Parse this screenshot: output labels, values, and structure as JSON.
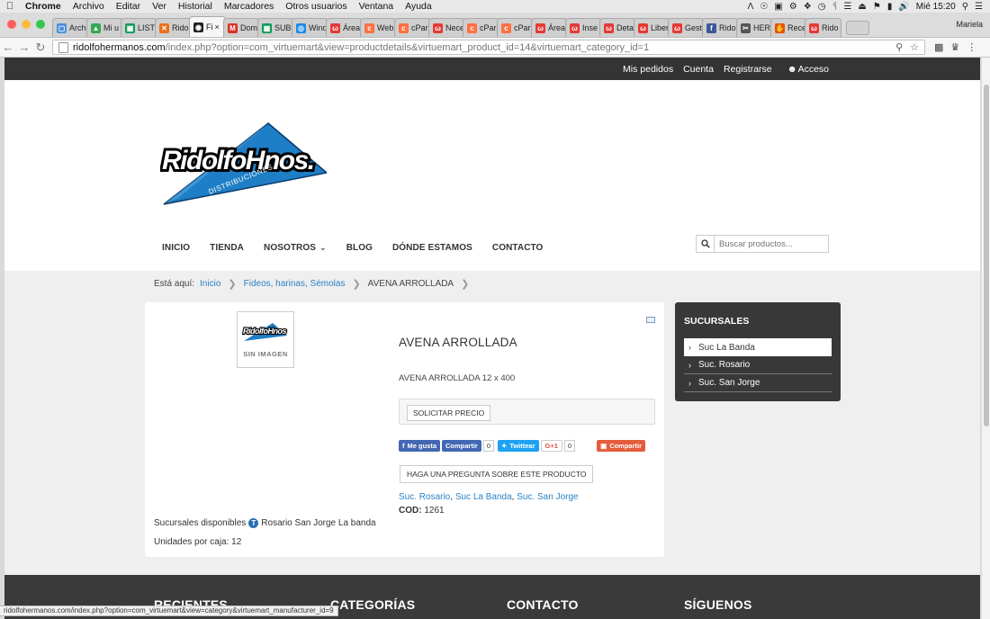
{
  "mac_menu": {
    "apple": "",
    "items": [
      "Chrome",
      "Archivo",
      "Editar",
      "Ver",
      "Historial",
      "Marcadores",
      "Otros usuarios",
      "Ventana",
      "Ayuda"
    ],
    "clock": "Mié 15:20"
  },
  "browser": {
    "tabs": [
      {
        "label": "Arch",
        "color": "#4a90d9",
        "glyph": "▢"
      },
      {
        "label": "Mi u",
        "color": "#34a853",
        "glyph": "▲"
      },
      {
        "label": "LIST",
        "color": "#0f9d58",
        "glyph": "▦"
      },
      {
        "label": "Rido",
        "color": "#e8711c",
        "glyph": "✕"
      },
      {
        "label": "Fi",
        "color": "#222222",
        "glyph": "◉",
        "active": true
      },
      {
        "label": "Dom",
        "color": "#d93025",
        "glyph": "M"
      },
      {
        "label": "SUB",
        "color": "#0f9d58",
        "glyph": "▦"
      },
      {
        "label": "Wind",
        "color": "#1e88e5",
        "glyph": "◎"
      },
      {
        "label": "Área",
        "color": "#e53935",
        "glyph": "ω"
      },
      {
        "label": "Web",
        "color": "#ff7043",
        "glyph": "c"
      },
      {
        "label": "cPar",
        "color": "#ff7043",
        "glyph": "c"
      },
      {
        "label": "Nece",
        "color": "#e53935",
        "glyph": "ω"
      },
      {
        "label": "cPar",
        "color": "#ff7043",
        "glyph": "c"
      },
      {
        "label": "cPar",
        "color": "#ff7043",
        "glyph": "c"
      },
      {
        "label": "Área",
        "color": "#e53935",
        "glyph": "ω"
      },
      {
        "label": "Inse",
        "color": "#e53935",
        "glyph": "ω"
      },
      {
        "label": "Deta",
        "color": "#e53935",
        "glyph": "ω"
      },
      {
        "label": "Liber",
        "color": "#e53935",
        "glyph": "ω"
      },
      {
        "label": "Gest",
        "color": "#e53935",
        "glyph": "ω"
      },
      {
        "label": "Rido",
        "color": "#3b5998",
        "glyph": "f"
      },
      {
        "label": "HER",
        "color": "#555555",
        "glyph": "✂"
      },
      {
        "label": "Rece",
        "color": "#e65100",
        "glyph": "✋"
      },
      {
        "label": "Rido",
        "color": "#e53935",
        "glyph": "ω"
      }
    ],
    "close_glyph": "×",
    "profile": "Mariela",
    "url_host": "ridolfohermanos.com",
    "url_rest": "/index.php?option=com_virtuemart&view=productdetails&virtuemart_product_id=14&virtuemart_category_id=1",
    "status_url": "ridolfohermanos.com/index.php?option=com_virtuemart&view=category&virtuemart_manufacturer_id=9"
  },
  "site": {
    "topbar": [
      "Mis pedidos",
      "Cuenta",
      "Registrarse",
      "Acceso"
    ],
    "logo_text": "RidolfoHnos.",
    "logo_sub": "DISTRIBUCIONES",
    "nav": [
      "INICIO",
      "TIENDA",
      "NOSOTROS",
      "BLOG",
      "DÓNDE ESTAMOS",
      "CONTACTO"
    ],
    "search_placeholder": "Buscar productos...",
    "breadcrumb": {
      "label": "Está aquí:",
      "items": [
        "Inicio",
        "Fideos, harinas, Sémolas",
        "AVENA ARROLLADA"
      ]
    },
    "product": {
      "img_logo": "RidolfoHnos",
      "no_image": "SIN IMAGEN",
      "title": "AVENA ARROLLADA",
      "description": "AVENA ARROLLADA 12 x 400",
      "price_button": "SOLICITAR PRECIO",
      "social": {
        "like": "Me gusta",
        "share": "Compartir",
        "share_count": "0",
        "tweet": "Twittear",
        "gplus": "G+1",
        "gplus_count": "0",
        "share2": "Compartir"
      },
      "ask_button": "HAGA UNA PREGUNTA SOBRE ESTE PRODUCTO",
      "branch_links": [
        "Suc. Rosario",
        "Suc La Banda",
        "Suc. San Jorge"
      ],
      "cod_label": "COD:",
      "cod_value": "1261",
      "branches_label": "Sucursales disponibles",
      "branches_value": "Rosario San Jorge La banda",
      "units_label": "Unidades por caja:",
      "units_value": "12"
    },
    "sidebar": {
      "title": "SUCURSALES",
      "items": [
        "Suc La Banda",
        "Suc. Rosario",
        "Suc. San Jorge"
      ]
    },
    "footer": [
      "RECIENTES",
      "CATEGORÍAS",
      "CONTACTO",
      "SÍGUENOS"
    ]
  }
}
